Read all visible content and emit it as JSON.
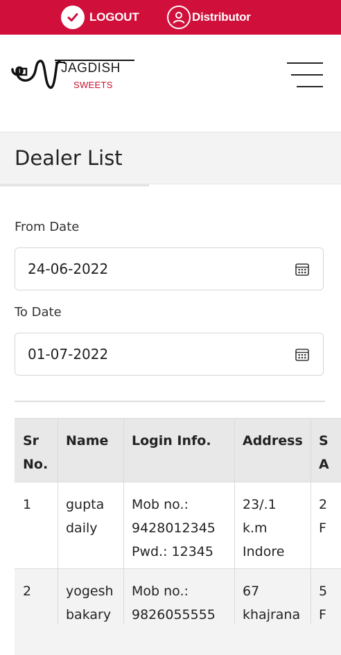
{
  "topbar": {
    "logout_label": "LOGOUT",
    "role_label": "Distributor",
    "logout_icon": "check-circle-icon",
    "role_icon": "user-icon",
    "bg_color": "#d0103a"
  },
  "header": {
    "logo_title": "JAGDISH",
    "logo_subtitle": "SWEETS",
    "menu_icon": "hamburger-menu-icon"
  },
  "page": {
    "title": "Dealer List"
  },
  "filters": {
    "from_label": "From Date",
    "from_value": "24-06-2022",
    "to_label": "To Date",
    "to_value": "01-07-2022",
    "calendar_icon": "calendar-icon"
  },
  "table": {
    "headers": {
      "sr": "Sr\nNo.",
      "name": "Name",
      "login": "Login Info.",
      "address": "Address",
      "extra": "S\nA"
    },
    "rows": [
      {
        "sr": "1",
        "name": "gupta\ndaily",
        "login": "Mob no.:\n9428012345\nPwd.: 12345",
        "address": "23/.1\nk.m\nIndore",
        "extra": "2\nF"
      },
      {
        "sr": "2",
        "name": "yogesh\nbakary",
        "login": "Mob no.:\n9826055555",
        "address": "67\nkhajrana",
        "extra": "5\nF"
      }
    ]
  }
}
